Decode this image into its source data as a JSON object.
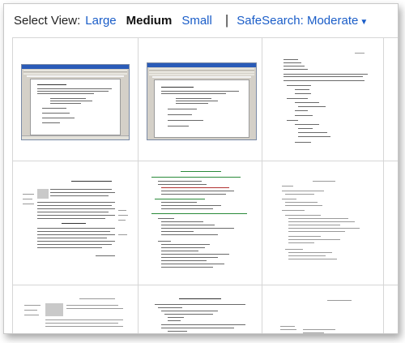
{
  "toolbar": {
    "select_view_label": "Select View:",
    "views": [
      "Large",
      "Medium",
      "Small"
    ],
    "active_view": "Medium",
    "separator": "|",
    "safesearch_label": "SafeSearch: Moderate",
    "safesearch_caret": "▼"
  },
  "results": {
    "thumbnails": [
      {
        "kind": "word-screenshot"
      },
      {
        "kind": "word-screenshot"
      },
      {
        "kind": "outline-document"
      },
      {
        "kind": "text-document"
      },
      {
        "kind": "outline-document"
      },
      {
        "kind": "outline-document"
      },
      {
        "kind": "text-document"
      },
      {
        "kind": "outline-document"
      },
      {
        "kind": "outline-document"
      }
    ]
  },
  "colors": {
    "link": "#1a5dc8",
    "active_view": "#111111",
    "grid_line": "#d6d6d6",
    "word_titlebar": "#2a5bb8"
  }
}
